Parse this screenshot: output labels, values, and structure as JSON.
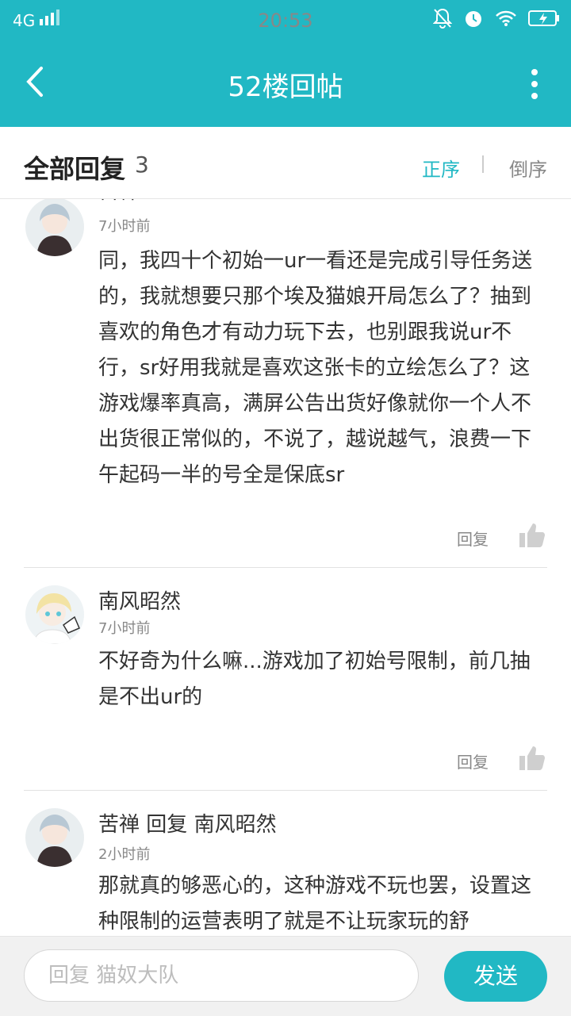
{
  "status_bar": {
    "network": "4G",
    "time": "20:53",
    "icons": [
      "signal-icon",
      "mute-bell-icon",
      "alarm-icon",
      "wifi-icon",
      "battery-charging-icon"
    ]
  },
  "navbar": {
    "title": "52楼回帖",
    "back_icon": "chevron-left-icon",
    "more_icon": "more-vertical-icon"
  },
  "replies_header": {
    "title": "全部回复",
    "count": "3",
    "sort_asc": "正序",
    "sort_desc": "倒序",
    "active_color": "#21b8c4"
  },
  "replies": [
    {
      "user": "苦禅",
      "time": "7小时前",
      "content": "同，我四十个初始一ur一看还是完成引导任务送的，我就想要只那个埃及猫娘开局怎么了？抽到喜欢的角色才有动力玩下去，也别跟我说ur不行，sr好用我就是喜欢这张卡的立绘怎么了？这游戏爆率真高，满屏公告出货好像就你一个人不出货很正常似的，不说了，越说越气，浪费一下午起码一半的号全是保底sr",
      "reply_label": "回复"
    },
    {
      "user": "南风昭然",
      "time": "7小时前",
      "content": "不好奇为什么嘛...游戏加了初始号限制，前几抽是不出ur的",
      "reply_label": "回复"
    },
    {
      "user": "苦禅",
      "reply_word": "回复",
      "reply_to": "南风昭然",
      "time": "2小时前",
      "content": "那就真的够恶心的，这种游戏不玩也罢，设置这种限制的运营表明了就是不让玩家玩的舒"
    }
  ],
  "bottom_bar": {
    "input_placeholder": "回复 猫奴大队",
    "send_label": "发送"
  },
  "colors": {
    "accent": "#21b8c4"
  }
}
